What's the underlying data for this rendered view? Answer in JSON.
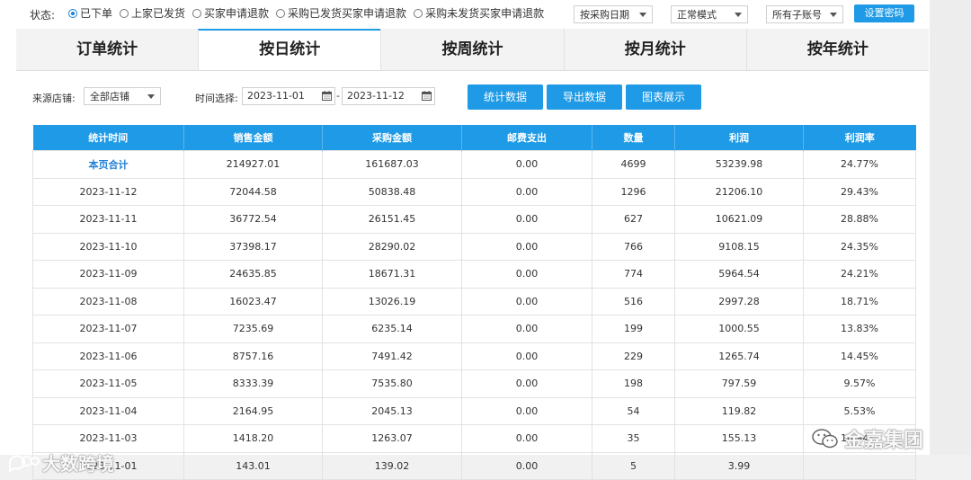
{
  "status": {
    "label": "状态:",
    "options": [
      "已下单",
      "上家已发货",
      "买家申请退款",
      "采购已发货买家申请退款",
      "采购未发货买家申请退款"
    ],
    "selected_index": 0
  },
  "toolbar": {
    "date_mode": "按采购日期",
    "display_mode": "正常模式",
    "account": "所有子账号",
    "set_password": "设置密码"
  },
  "tabs": [
    "订单统计",
    "按日统计",
    "按周统计",
    "按月统计",
    "按年统计"
  ],
  "active_tab": 1,
  "filters": {
    "shop_label": "来源店铺:",
    "shop_value": "全部店铺",
    "time_label": "时间选择:",
    "date_from": "2023-11-01",
    "date_to": "2023-11-12",
    "separator": "-"
  },
  "actions": {
    "stats": "统计数据",
    "export": "导出数据",
    "chart": "图表展示"
  },
  "table": {
    "columns": [
      "统计时间",
      "销售金额",
      "采购金额",
      "邮费支出",
      "数量",
      "利润",
      "利润率"
    ],
    "rows": [
      [
        "本页合计",
        "214927.01",
        "161687.03",
        "0.00",
        "4699",
        "53239.98",
        "24.77%"
      ],
      [
        "2023-11-12",
        "72044.58",
        "50838.48",
        "0.00",
        "1296",
        "21206.10",
        "29.43%"
      ],
      [
        "2023-11-11",
        "36772.54",
        "26151.45",
        "0.00",
        "627",
        "10621.09",
        "28.88%"
      ],
      [
        "2023-11-10",
        "37398.17",
        "28290.02",
        "0.00",
        "766",
        "9108.15",
        "24.35%"
      ],
      [
        "2023-11-09",
        "24635.85",
        "18671.31",
        "0.00",
        "774",
        "5964.54",
        "24.21%"
      ],
      [
        "2023-11-08",
        "16023.47",
        "13026.19",
        "0.00",
        "516",
        "2997.28",
        "18.71%"
      ],
      [
        "2023-11-07",
        "7235.69",
        "6235.14",
        "0.00",
        "199",
        "1000.55",
        "13.83%"
      ],
      [
        "2023-11-06",
        "8757.16",
        "7491.42",
        "0.00",
        "229",
        "1265.74",
        "14.45%"
      ],
      [
        "2023-11-05",
        "8333.39",
        "7535.80",
        "0.00",
        "198",
        "797.59",
        "9.57%"
      ],
      [
        "2023-11-04",
        "2164.95",
        "2045.13",
        "0.00",
        "54",
        "119.82",
        "5.53%"
      ],
      [
        "2023-11-03",
        "1418.20",
        "1263.07",
        "0.00",
        "35",
        "155.13",
        "10.94%"
      ],
      [
        "2023-11-01",
        "143.01",
        "139.02",
        "0.00",
        "5",
        "3.99",
        ""
      ]
    ]
  },
  "watermarks": {
    "left": "大数跨境",
    "right": "金嘉集团"
  },
  "colors": {
    "accent": "#1e9ae6",
    "total_text": "#1e7fd6"
  }
}
